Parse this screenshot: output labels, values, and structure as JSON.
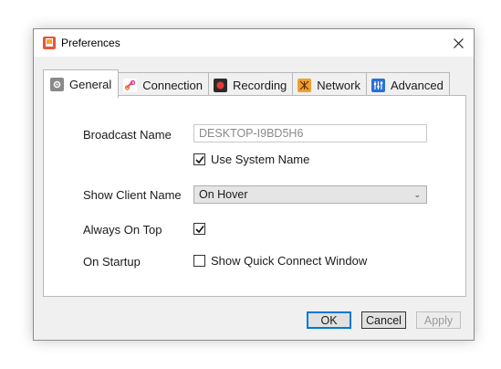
{
  "window": {
    "title": "Preferences",
    "accent_color": "#e8553a"
  },
  "tabs": [
    {
      "label": "General",
      "icon": "gear-icon",
      "color": "#8a8a8a",
      "active": true
    },
    {
      "label": "Connection",
      "icon": "link-icon",
      "color": "#ffffff",
      "active": false
    },
    {
      "label": "Recording",
      "icon": "record-icon",
      "color": "#2b2b2b",
      "active": false
    },
    {
      "label": "Network",
      "icon": "network-icon",
      "color": "#f0a030",
      "active": false
    },
    {
      "label": "Advanced",
      "icon": "sliders-icon",
      "color": "#2b6fd6",
      "active": false
    }
  ],
  "general": {
    "broadcast_name_label": "Broadcast Name",
    "broadcast_name_value": "DESKTOP-I9BD5H6",
    "use_system_name_label": "Use System Name",
    "use_system_name_checked": true,
    "show_client_name_label": "Show Client Name",
    "show_client_name_value": "On Hover",
    "always_on_top_label": "Always On Top",
    "always_on_top_checked": true,
    "on_startup_label": "On Startup",
    "show_quick_connect_label": "Show Quick Connect Window",
    "show_quick_connect_checked": false
  },
  "buttons": {
    "ok": "OK",
    "cancel": "Cancel",
    "apply": "Apply"
  }
}
